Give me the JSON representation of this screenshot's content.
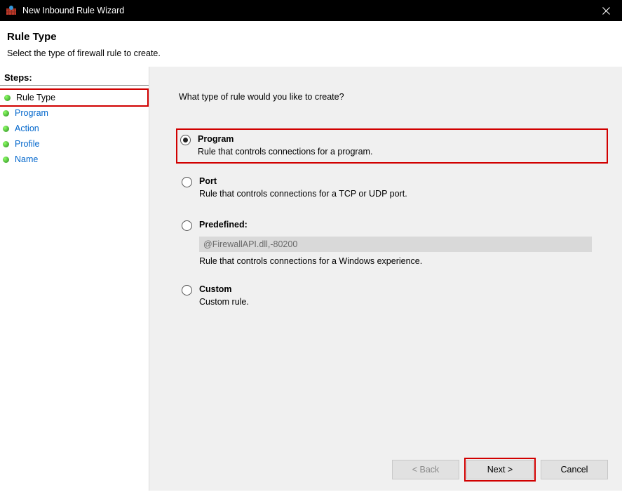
{
  "titlebar": {
    "title": "New Inbound Rule Wizard"
  },
  "header": {
    "heading": "Rule Type",
    "subheading": "Select the type of firewall rule to create."
  },
  "sidebar": {
    "label": "Steps:",
    "items": [
      {
        "label": "Rule Type",
        "current": true
      },
      {
        "label": "Program"
      },
      {
        "label": "Action"
      },
      {
        "label": "Profile"
      },
      {
        "label": "Name"
      }
    ]
  },
  "main": {
    "question": "What type of rule would you like to create?",
    "options": [
      {
        "title": "Program",
        "desc": "Rule that controls connections for a program.",
        "selected": true
      },
      {
        "title": "Port",
        "desc": "Rule that controls connections for a TCP or UDP port."
      },
      {
        "title": "Predefined:",
        "desc": "Rule that controls connections for a Windows experience.",
        "predefined_value": "@FirewallAPI.dll,-80200"
      },
      {
        "title": "Custom",
        "desc": "Custom rule."
      }
    ]
  },
  "buttons": {
    "back": "< Back",
    "next": "Next >",
    "cancel": "Cancel"
  }
}
